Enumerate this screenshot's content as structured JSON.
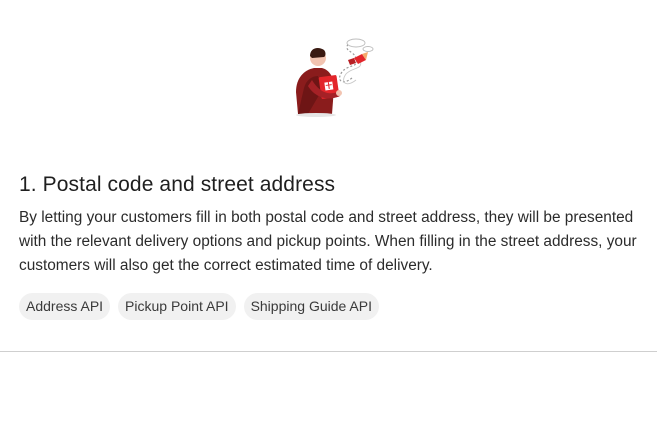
{
  "section": {
    "title": "1. Postal code and street address",
    "body": "By letting your customers fill in both postal code and street address, they will be presented with the relevant delivery options and pickup points. When filling in the street address, your customers will also get the correct estimated time of delivery.",
    "illustration_icon": "delivery-person-with-parcel-icon",
    "tags": [
      {
        "label": "Address API"
      },
      {
        "label": "Pickup Point API"
      },
      {
        "label": "Shipping Guide API"
      }
    ]
  },
  "colors": {
    "accent_red": "#e3262b",
    "dark_red": "#8a1c1c",
    "chip_background": "#f1f1f1",
    "divider": "#cfcfcf"
  }
}
